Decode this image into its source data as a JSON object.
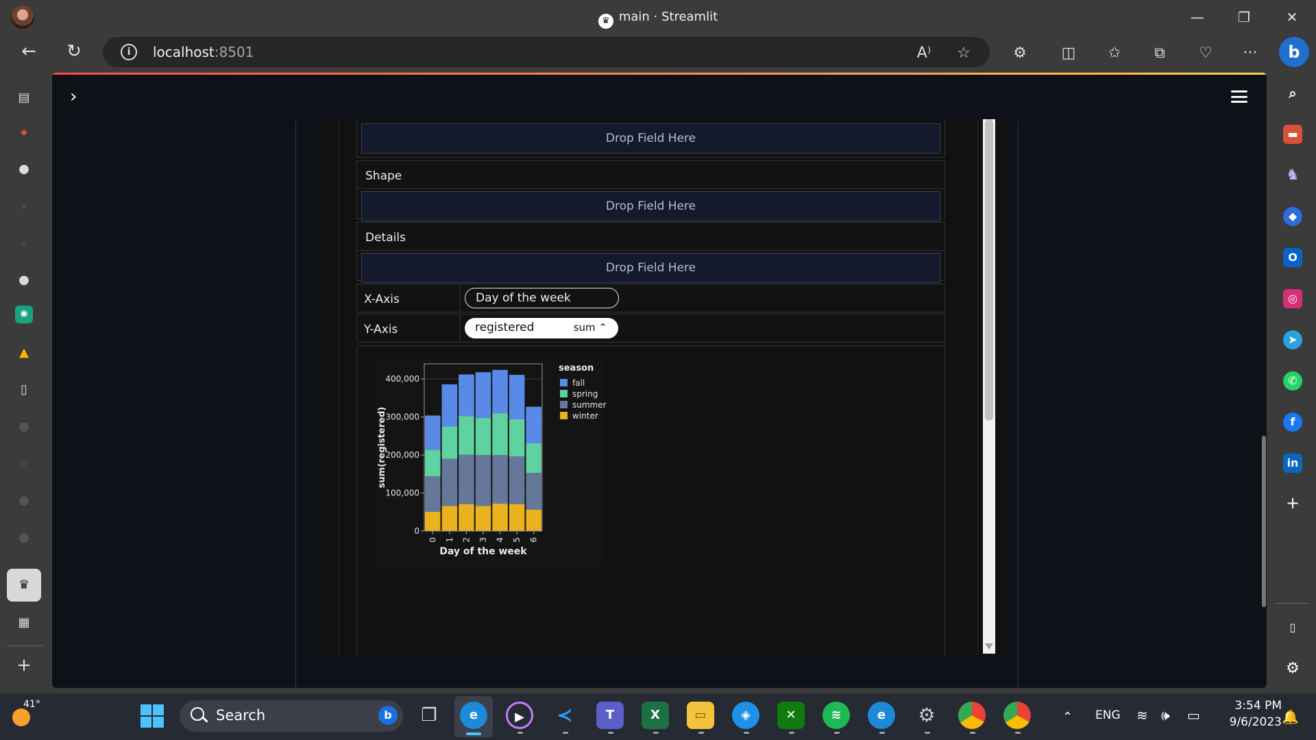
{
  "browser": {
    "window_title": "main · Streamlit",
    "url_host": "localhost",
    "url_port": ":8501"
  },
  "streamlit": {
    "drop_placeholder": "Drop Field Here",
    "shape_label": "Shape",
    "details_label": "Details",
    "x_axis_label": "X-Axis",
    "y_axis_label": "Y-Axis",
    "x_field": "Day of the week",
    "y_field": "registered",
    "y_aggregation": "sum ⌃",
    "colors": {
      "accent": "#ff4b4b",
      "background": "#0e1117"
    }
  },
  "chart_data": {
    "type": "bar",
    "stacked": true,
    "xlabel": "Day of the week",
    "ylabel": "sum(registered)",
    "categories": [
      "0",
      "1",
      "2",
      "3",
      "4",
      "5",
      "6"
    ],
    "ylim": [
      0,
      440000
    ],
    "yticks": [
      "0",
      "100,000",
      "200,000",
      "300,000",
      "400,000"
    ],
    "ytick_values": [
      0,
      100000,
      200000,
      300000,
      400000
    ],
    "legend_title": "season",
    "legend_position": "right",
    "series": [
      {
        "name": "winter",
        "color": "#e9b21f",
        "values": [
          51000,
          66000,
          71000,
          66000,
          72000,
          71000,
          56000
        ]
      },
      {
        "name": "summer",
        "color": "#66789a",
        "values": [
          93000,
          124000,
          130000,
          134000,
          128000,
          125000,
          97000
        ]
      },
      {
        "name": "spring",
        "color": "#5ed3a0",
        "values": [
          70000,
          85000,
          101000,
          98000,
          110000,
          98000,
          78000
        ]
      },
      {
        "name": "fall",
        "color": "#5a8ae8",
        "values": [
          90000,
          111000,
          110000,
          120000,
          114000,
          117000,
          96000
        ]
      }
    ],
    "legend_order": [
      "fall",
      "spring",
      "summer",
      "winter"
    ]
  },
  "taskbar": {
    "weather_temp": "41°",
    "search_label": "Search",
    "language": "ENG",
    "time": "3:54 PM",
    "date": "9/6/2023"
  },
  "icons": {
    "left_strip": [
      "tab-actions-icon",
      "airflow-icon",
      "github-icon",
      "search-icon",
      "search-icon",
      "github-icon",
      "chatgpt-icon",
      "google-drive-icon",
      "document-icon",
      "generic-site-icon",
      "search-icon",
      "generic-site-icon",
      "generic-site-icon",
      "streamlit-icon",
      "calendar-icon",
      "add-tab-icon"
    ],
    "right_strip": [
      "search-icon",
      "toolbox-icon",
      "games-icon",
      "copilot-icon",
      "outlook-icon",
      "instagram-icon",
      "telegram-icon",
      "whatsapp-icon",
      "facebook-icon",
      "linkedin-icon",
      "add-icon",
      "split-screen-icon",
      "settings-icon"
    ]
  }
}
